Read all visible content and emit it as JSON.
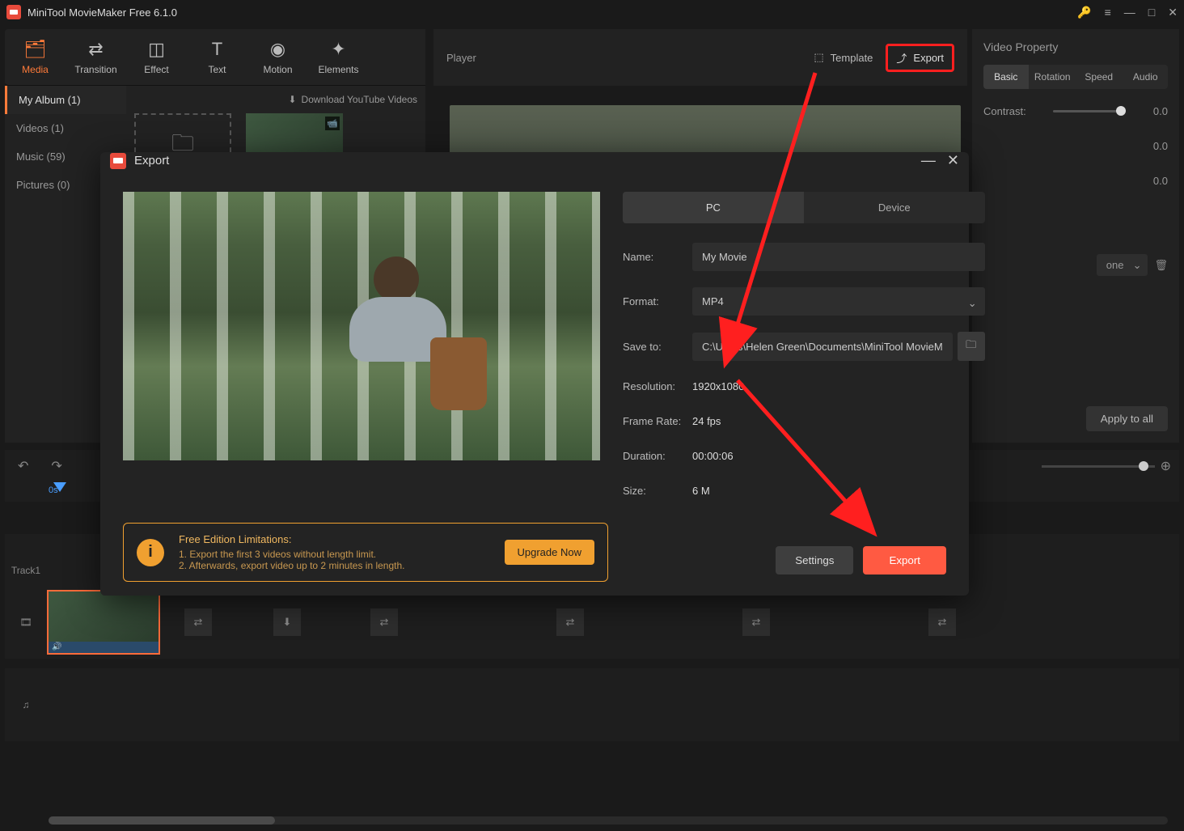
{
  "titlebar": {
    "title": "MiniTool MovieMaker Free 6.1.0"
  },
  "toolbar": {
    "media": "Media",
    "transition": "Transition",
    "effect": "Effect",
    "text": "Text",
    "motion": "Motion",
    "elements": "Elements"
  },
  "player": {
    "label": "Player",
    "template": "Template",
    "export": "Export"
  },
  "rightPanel": {
    "title": "Video Property",
    "tabs": {
      "basic": "Basic",
      "rotation": "Rotation",
      "speed": "Speed",
      "audio": "Audio"
    },
    "contrast": "Contrast:",
    "val0": "0.0",
    "val1": "0.0",
    "val2": "0.0",
    "dropdown": "one",
    "apply": "Apply to all"
  },
  "sidebar": {
    "album": "My Album (1)",
    "videos": "Videos (1)",
    "music": "Music (59)",
    "pictures": "Pictures (0)"
  },
  "media": {
    "download": "Download YouTube Videos"
  },
  "timeline": {
    "zero": "0s",
    "track1": "Track1"
  },
  "modal": {
    "title": "Export",
    "tabPC": "PC",
    "tabDevice": "Device",
    "nameLbl": "Name:",
    "nameVal": "My Movie",
    "formatLbl": "Format:",
    "formatVal": "MP4",
    "saveLbl": "Save to:",
    "saveVal": "C:\\Users\\Helen Green\\Documents\\MiniTool MovieM",
    "resLbl": "Resolution:",
    "resVal": "1920x1080",
    "fpsLbl": "Frame Rate:",
    "fpsVal": "24 fps",
    "durLbl": "Duration:",
    "durVal": "00:00:06",
    "sizeLbl": "Size:",
    "sizeVal": "6 M",
    "limitTitle": "Free Edition Limitations:",
    "limit1": "1. Export the first 3 videos without length limit.",
    "limit2": "2. Afterwards, export video up to 2 minutes in length.",
    "upgrade": "Upgrade Now",
    "settings": "Settings",
    "exportBtn": "Export"
  }
}
